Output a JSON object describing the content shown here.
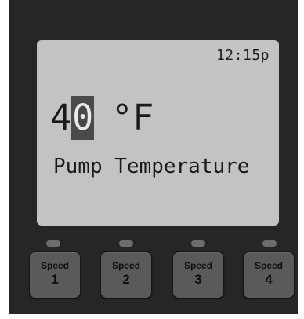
{
  "display": {
    "clock": "12:15p",
    "temperature_digit_1": "4",
    "temperature_digit_2": "0",
    "temperature_unit": "°F",
    "label": "Pump Temperature"
  },
  "speed_buttons": [
    {
      "name": "Speed",
      "number": "1",
      "led_active": false
    },
    {
      "name": "Speed",
      "number": "2",
      "led_active": false
    },
    {
      "name": "Speed",
      "number": "3",
      "led_active": false
    },
    {
      "name": "Speed",
      "number": "4",
      "led_active": false
    }
  ],
  "colors": {
    "panel": "#262626",
    "lcd_background": "#c3c3c3",
    "lcd_text": "#1a1a1a",
    "button": "#5a5a5a",
    "led_off": "#6d6d6d"
  }
}
